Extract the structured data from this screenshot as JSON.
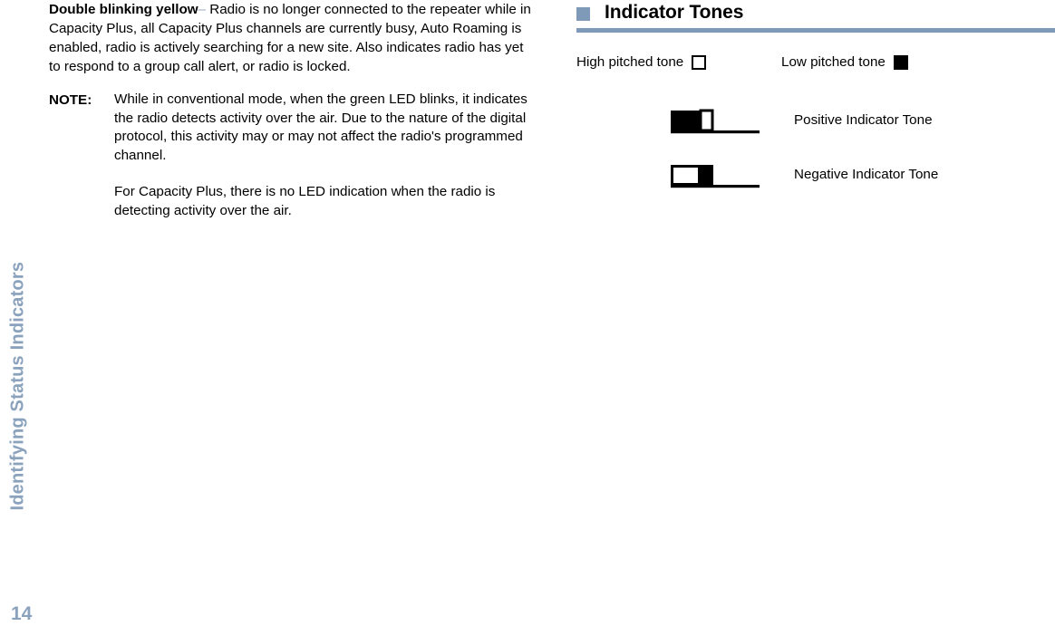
{
  "side_tab": {
    "running_head": "Identifying Status Indicators",
    "page_number": "14",
    "color": "#8ba2bd"
  },
  "left_column": {
    "paragraph": {
      "lead_term": "Double blinking yellow",
      "dash": "–",
      "text": " Radio is no longer connected to the repeater while in Capacity Plus, all Capacity Plus channels are currently busy, Auto Roaming is enabled, radio is actively searching for a new site. Also indicates radio has yet to respond to a group call alert, or radio is locked."
    },
    "note": {
      "label": "NOTE:",
      "paragraphs": [
        "While in conventional mode, when the green LED blinks, it indicates the radio detects activity over the air. Due to the nature of the digital protocol, this activity may or may not affect the radio's programmed channel.",
        "For Capacity Plus, there is no LED indication when the radio is detecting activity over the air."
      ]
    }
  },
  "right_column": {
    "heading": "Indicator Tones",
    "accent_color": "#7f9ab8",
    "legend": [
      {
        "label": "High pitched tone",
        "swatch": "open-square"
      },
      {
        "label": "Low pitched tone",
        "swatch": "solid-square"
      }
    ],
    "tones": [
      {
        "label": "Positive Indicator Tone",
        "pattern": "low-then-high"
      },
      {
        "label": "Negative Indicator Tone",
        "pattern": "high-then-low"
      }
    ]
  }
}
